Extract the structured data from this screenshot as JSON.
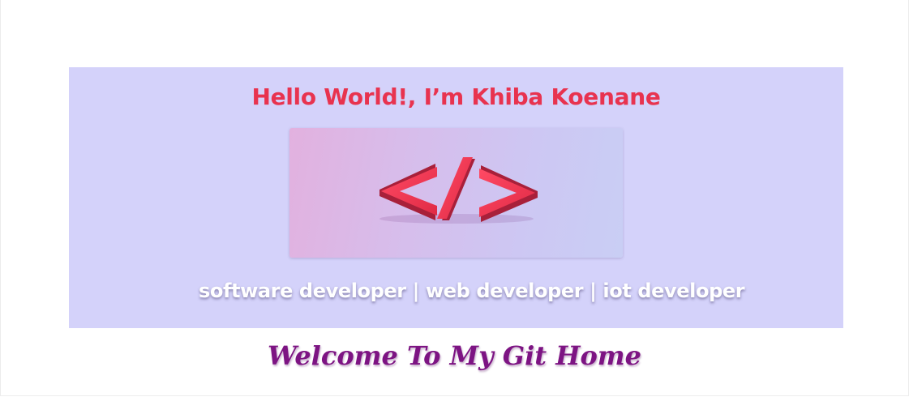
{
  "hero": {
    "title": "Hello World!, I’m Khiba Koenane",
    "image": {
      "icon": "code-brackets-icon",
      "accent_color": "#e8334f"
    },
    "roles": "software developer | web developer | iot developer",
    "background_color": "#d4d2fa"
  },
  "welcome": {
    "text": "Welcome To My Git Home",
    "color": "#7d1483"
  }
}
